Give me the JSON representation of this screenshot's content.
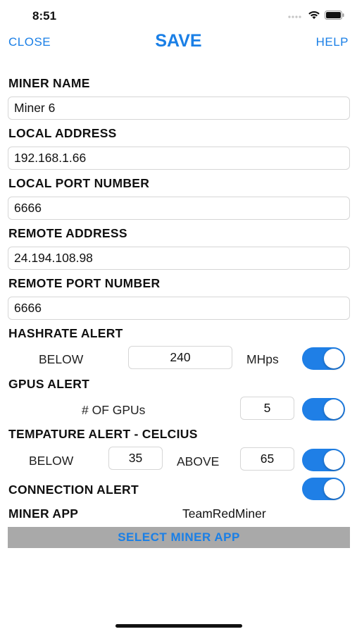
{
  "status_bar": {
    "time": "8:51"
  },
  "nav": {
    "close_label": "CLOSE",
    "save_label": "SAVE",
    "help_label": "HELP"
  },
  "form": {
    "miner_name": {
      "label": "MINER NAME",
      "value": "Miner 6"
    },
    "local_address": {
      "label": "LOCAL ADDRESS",
      "value": "192.168.1.66"
    },
    "local_port": {
      "label": "LOCAL PORT NUMBER",
      "value": "6666"
    },
    "remote_address": {
      "label": "REMOTE ADDRESS",
      "value": "24.194.108.98"
    },
    "remote_port": {
      "label": "REMOTE PORT NUMBER",
      "value": "6666"
    },
    "hashrate_alert": {
      "label": "HASHRATE ALERT",
      "below_label": "BELOW",
      "value": "240",
      "unit": "MHps",
      "enabled": true
    },
    "gpus_alert": {
      "label": "GPUS ALERT",
      "count_label": "# OF GPUs",
      "value": "5",
      "enabled": true
    },
    "temperature_alert": {
      "label": "TEMPATURE ALERT - CELCIUS",
      "below_label": "BELOW",
      "below_value": "35",
      "above_label": "ABOVE",
      "above_value": "65",
      "enabled": true
    },
    "connection_alert": {
      "label": "CONNECTION ALERT",
      "enabled": true
    },
    "miner_app": {
      "label": "MINER APP",
      "value": "TeamRedMiner"
    },
    "select_button_label": "SELECT MINER APP"
  },
  "colors": {
    "accent": "#1a7fe6",
    "toggle_on": "#1f7fe6",
    "button_bg": "#a9a9a9"
  },
  "icons": [
    "signal-icon",
    "wifi-icon",
    "battery-icon"
  ]
}
